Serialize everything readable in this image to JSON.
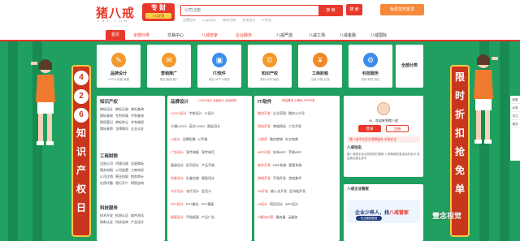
{
  "header": {
    "logo_text": "猪八戒",
    "logo_sub": "Z B J . C O M",
    "promo_top": "专 财",
    "promo_bottom": "9元发票",
    "search_placeholder": "公司注册",
    "search_button": "搜 索",
    "search_extra": "搜 索",
    "hot_words": [
      "品牌设计",
      "Logo设计",
      "商标注册",
      "外观设计",
      "IT外包"
    ],
    "post_button": "免费发布需求"
  },
  "nav": {
    "items": [
      "首页",
      "全部分类",
      "交易中心",
      "八戒管家",
      "企业服务",
      "八戒严选",
      "八戒工场",
      "八戒金融",
      "八戒国际"
    ]
  },
  "banner": {
    "left_chars": [
      "4",
      "2",
      "6",
      "知",
      "识",
      "产",
      "权",
      "日"
    ],
    "right_chars": [
      "限",
      "时",
      "折",
      "扣",
      "抢",
      "免",
      "单"
    ]
  },
  "categories": [
    {
      "label": "品牌设计",
      "sub": "LOGO 包装 海报",
      "icon": "✎",
      "color": "#f49a2c"
    },
    {
      "label": "营销推广",
      "sub": "策划 营销 推广",
      "icon": "✉",
      "color": "#f49a2c"
    },
    {
      "label": "IT/软件",
      "sub": "网站 APP 小程序",
      "icon": "▣",
      "color": "#3b8ded"
    },
    {
      "label": "知识产权",
      "sub": "商标 专利 版权",
      "icon": "©",
      "color": "#f49a2c"
    },
    {
      "label": "工商财税",
      "sub": "注册 代账 社保",
      "icon": "¥",
      "color": "#f08a24"
    },
    {
      "label": "科技服务",
      "sub": "咨询 研发 测试",
      "icon": "⚙",
      "color": "#3b8ded"
    }
  ],
  "all_categories": "全部分类",
  "sections": {
    "ip": {
      "title": "知识产权",
      "rows": [
        [
          "商标设计",
          "商标注册",
          "商标查询"
        ],
        [
          "商标查询",
          "专利申请",
          "专利查询"
        ],
        [
          "版权登记",
          "商标转让",
          "专利维权"
        ],
        [
          "商标复审",
          "法律顾问",
          "企业认证"
        ]
      ]
    },
    "biz": {
      "title": "工商财税",
      "rows": [
        [
          "注册公司",
          "代理记账",
          "注册商标"
        ],
        [
          "税务申报",
          "公司变更",
          "工商年检"
        ],
        [
          "公司注销",
          "营业执照",
          "财务审计"
        ],
        [
          "社保代缴",
          "银行开户",
          "财税咨询"
        ]
      ]
    },
    "tech": {
      "title": "科技服务",
      "rows": [
        [
          "技术开发",
          "检测认证",
          "软件测试"
        ],
        [
          "高新认定",
          "科技咨询",
          "产品设计"
        ]
      ]
    },
    "brand": {
      "title": "品牌设计",
      "subtitle": "LOGO设计 包装设计 活动抢购",
      "rows": [
        [
          "LOGO设计",
          "字体设计",
          "VI设计"
        ],
        [
          "卡通LOGO",
          "英文LOGO",
          "图标设计"
        ],
        [
          "VI设计",
          "品牌形象",
          "VI手册"
        ],
        [
          "广告设计",
          "宣传海报",
          "宣传单页"
        ],
        [
          "画册设计",
          "折页设计",
          "产品手册"
        ],
        [
          "包装设计",
          "礼盒包装",
          "瓶贴设计"
        ],
        [
          "卡片设计",
          "名片设计",
          "会员卡"
        ],
        [
          "PPT设计",
          "PPT美化",
          "PPT模板"
        ],
        [
          "插画设计",
          "手绘插画",
          "产品广告"
        ]
      ]
    },
    "it": {
      "title": "IT/软件",
      "subtitle": "网站建设 小程序 APP开发",
      "rows": [
        [
          "微信开发",
          "企业官网",
          "微信公众号"
        ],
        [
          "网站开发",
          "商城网站",
          "二次开发"
        ],
        [
          "小程序",
          "微信商城",
          "社交电商"
        ],
        [
          "APP开发",
          "安卓APP",
          "苹果APP"
        ],
        [
          "软件开发",
          "ERP系统",
          "管理系统"
        ],
        [
          "游戏开发",
          "手游开发",
          "游戏美术"
        ],
        [
          "H5开发",
          "嵌入式开发",
          "区块链开发"
        ],
        [
          "UI设计",
          "网页设计",
          "APP设计"
        ],
        [
          "IT解决方案",
          "服务器",
          "云服务"
        ]
      ]
    }
  },
  "user": {
    "greeting": "Hi，欢迎来到猪八戒",
    "login": "登录",
    "register": "注册",
    "tip": "猪八戒平台官方保障服务 交易安全",
    "dynamic_title": "八戒动态",
    "dynamic_text": "猪八戒网平台业务规则已更新 八戒商城优惠活动开启中 欢迎各位雇主参与"
  },
  "manager": {
    "title": "八戒企业管家",
    "slogan_a": "企业少养人，找",
    "slogan_b": "八戒管家",
    "chip": "专业管家服务"
  },
  "watermark": "壹念视觉",
  "rightbar": [
    "客服",
    "反馈",
    "关注",
    "置顶"
  ],
  "colors": {
    "brand_red": "#e8382c",
    "banner_green": "#20a060",
    "accent_orange": "#f7893b",
    "banner_gold": "#f7c948"
  }
}
